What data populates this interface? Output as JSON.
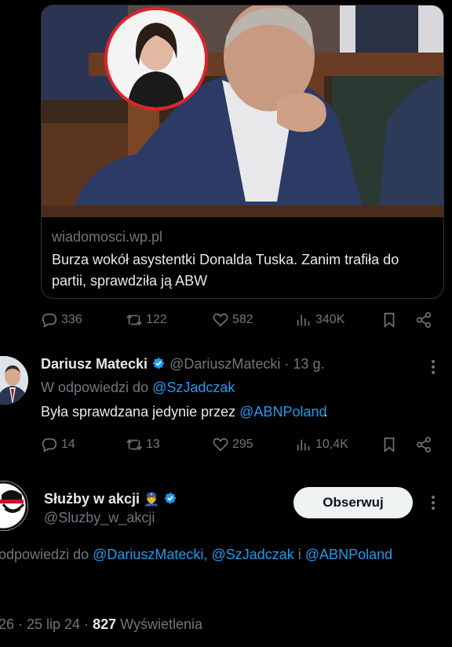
{
  "card": {
    "domain": "wiadomosci.wp.pl",
    "title": "Burza wokół asystentki Donalda Tuska. Zanim trafiła do partii, sprawdziła ją ABW"
  },
  "tweet1_actions": {
    "replies": "336",
    "retweets": "122",
    "likes": "582",
    "views": "340K"
  },
  "reply": {
    "name": "Dariusz Matecki",
    "handle": "@DariuszMatecki",
    "time": "· 13 g.",
    "reply_to_prefix": "W odpowiedzi do",
    "reply_to": "@SzJadczak",
    "text_prefix": "Była sprawdzana jedynie przez",
    "text_link": "@ABNPoland",
    "text_suffix": ".",
    "actions": {
      "replies": "14",
      "retweets": "13",
      "likes": "295",
      "views": "10,4K"
    }
  },
  "main": {
    "name": "Służby w akcji",
    "name_emoji": "👮",
    "handle": "@Sluzby_w_akcji",
    "follow_label": "Obserwuj",
    "reply_to_prefix": "odpowiedzi do",
    "reply_to_1": "@DariuszMatecki,",
    "reply_to_2": "@SzJadczak",
    "reply_to_sep": "i",
    "reply_to_3": "@ABNPoland",
    "time_partial": "26 · 25 lip 24 ·",
    "views_count": "827",
    "views_label": "Wyświetlenia"
  },
  "colors": {
    "accent": "#1d9bf0",
    "muted": "#71767b",
    "text": "#e7e9ea",
    "bg": "#000000"
  }
}
